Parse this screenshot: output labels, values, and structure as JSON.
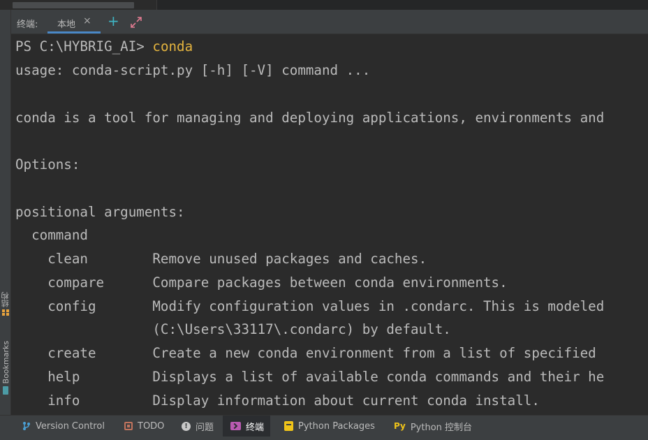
{
  "terminal_header": {
    "title": "终端:",
    "tab_label": "本地",
    "tab_close": "×",
    "add_symbol": "+"
  },
  "terminal_lines": [
    {
      "prefix": "PS C:\\HYBRIG_AI> ",
      "command": "conda"
    },
    {
      "text": "usage: conda-script.py [-h] [-V] command ..."
    },
    {
      "text": ""
    },
    {
      "text": "conda is a tool for managing and deploying applications, environments and"
    },
    {
      "text": ""
    },
    {
      "text": "Options:"
    },
    {
      "text": ""
    },
    {
      "text": "positional arguments:"
    },
    {
      "text": "  command"
    },
    {
      "text": "    clean        Remove unused packages and caches."
    },
    {
      "text": "    compare      Compare packages between conda environments."
    },
    {
      "text": "    config       Modify configuration values in .condarc. This is modeled"
    },
    {
      "text": "                 (C:\\Users\\33117\\.condarc) by default."
    },
    {
      "text": "    create       Create a new conda environment from a list of specified"
    },
    {
      "text": "    help         Displays a list of available conda commands and their he"
    },
    {
      "text": "    info         Display information about current conda install."
    }
  ],
  "left_strip": {
    "structure_label": "结构",
    "bookmarks_label": "Bookmarks"
  },
  "bottom_bar": {
    "items": [
      {
        "label": "Version Control",
        "icon": "branch-icon"
      },
      {
        "label": "TODO",
        "icon": "todo-icon"
      },
      {
        "label": "问题",
        "icon": "problems-icon",
        "icon_glyph": "!"
      },
      {
        "label": "终端",
        "icon": "terminal-icon",
        "active": true
      },
      {
        "label": "Python Packages",
        "icon": "package-icon"
      },
      {
        "label": "Python 控制台",
        "icon": "python-console-icon",
        "icon_glyph": "Py"
      }
    ]
  },
  "colors": {
    "background": "#2b2b2b",
    "panel": "#3c3f41",
    "accent_tab": "#4a88c7",
    "command_text": "#e4b43f",
    "add_button": "#3fb5c4"
  }
}
